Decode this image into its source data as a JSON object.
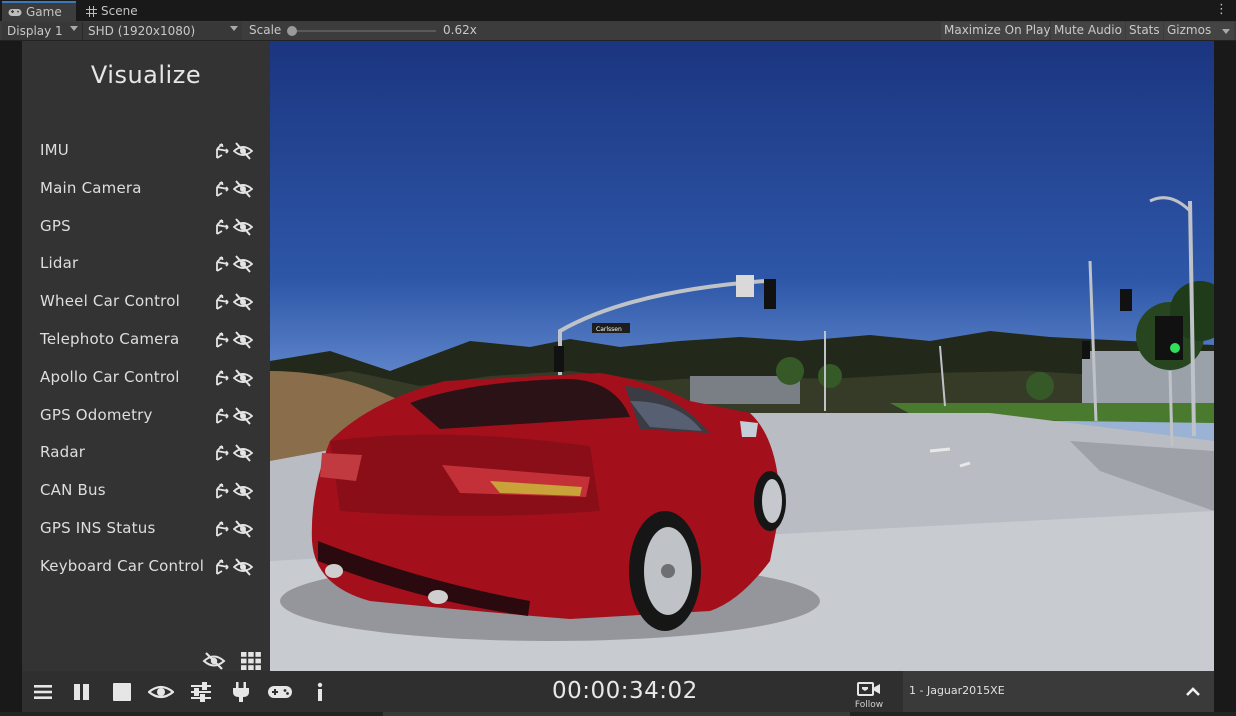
{
  "tabs": [
    {
      "label": "Game",
      "icon": "gamepad-icon"
    },
    {
      "label": "Scene",
      "icon": "grid-icon"
    }
  ],
  "toolbar": {
    "display": "Display 1",
    "resolution": "SHD (1920x1080)",
    "scale_label": "Scale",
    "scale_value": "0.62x",
    "maximize": "Maximize On Play",
    "mute": "Mute Audio",
    "stats": "Stats",
    "gizmos": "Gizmos"
  },
  "visualize": {
    "title": "Visualize",
    "items": [
      {
        "label": "IMU"
      },
      {
        "label": "Main Camera"
      },
      {
        "label": "GPS"
      },
      {
        "label": "Lidar"
      },
      {
        "label": "Wheel Car Control"
      },
      {
        "label": "Telephoto Camera"
      },
      {
        "label": "Apollo Car Control"
      },
      {
        "label": "GPS Odometry"
      },
      {
        "label": "Radar"
      },
      {
        "label": "CAN Bus"
      },
      {
        "label": "GPS INS Status"
      },
      {
        "label": "Keyboard Car Control"
      }
    ]
  },
  "scene": {
    "street_sign": "Carlssen"
  },
  "bottom_bar": {
    "icons": [
      "menu-icon",
      "pause-icon",
      "stop-icon",
      "eye-icon",
      "sliders-icon",
      "plug-icon",
      "gamepad-icon",
      "info-icon"
    ],
    "timer": "00:00:34:02",
    "follow_label": "Follow",
    "vehicle": "1 - Jaguar2015XE"
  },
  "colors": {
    "panel_bg": "#333333",
    "bar_bg": "#2f2f2f",
    "car_red": "#a3101c",
    "sky_top": "#1b3580",
    "tab_accent": "#3a79bb"
  }
}
